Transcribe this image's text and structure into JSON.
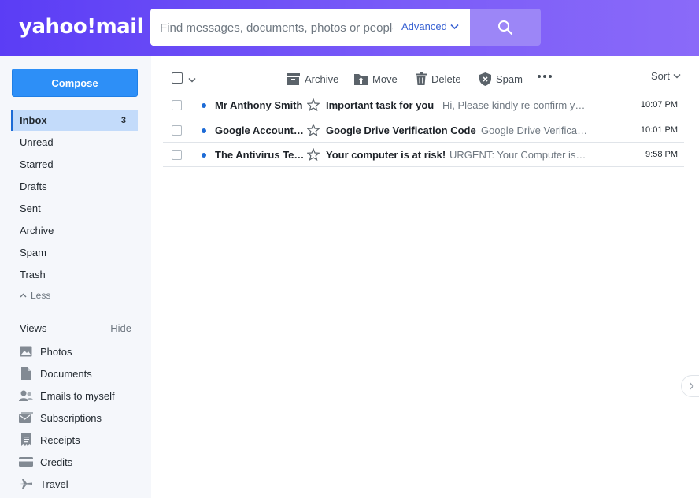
{
  "header": {
    "logo_text": "yahoo!mail",
    "search_placeholder": "Find messages, documents, photos or people",
    "advanced_label": "Advanced",
    "accent_color": "#5b3df5"
  },
  "sidebar": {
    "compose_label": "Compose",
    "folders": [
      {
        "label": "Inbox",
        "count": "3",
        "active": true
      },
      {
        "label": "Unread"
      },
      {
        "label": "Starred"
      },
      {
        "label": "Drafts"
      },
      {
        "label": "Sent"
      },
      {
        "label": "Archive"
      },
      {
        "label": "Spam"
      },
      {
        "label": "Trash"
      }
    ],
    "less_label": "Less",
    "views_label": "Views",
    "views_hide_label": "Hide",
    "views": [
      {
        "label": "Photos",
        "icon": "photo-icon"
      },
      {
        "label": "Documents",
        "icon": "document-icon"
      },
      {
        "label": "Emails to myself",
        "icon": "people-icon"
      },
      {
        "label": "Subscriptions",
        "icon": "subscriptions-icon"
      },
      {
        "label": "Receipts",
        "icon": "receipt-icon"
      },
      {
        "label": "Credits",
        "icon": "credit-card-icon"
      },
      {
        "label": "Travel",
        "icon": "plane-icon"
      }
    ]
  },
  "toolbar": {
    "archive_label": "Archive",
    "move_label": "Move",
    "delete_label": "Delete",
    "spam_label": "Spam",
    "sort_label": "Sort"
  },
  "messages": [
    {
      "sender": "Mr Anthony Smith",
      "subject": "Important task for you",
      "preview": "Hi, Please kindly re-confirm your details",
      "time": "10:07 PM",
      "unread": true
    },
    {
      "sender": "Google Accounts Team",
      "subject": "Google Drive Verification Code",
      "preview": "Google Drive Verification Code",
      "time": "10:01 PM",
      "unread": true
    },
    {
      "sender": "The Antivirus Team",
      "subject": "Your computer is at risk!",
      "preview": "URGENT: Your Computer is at risk",
      "time": "9:58 PM",
      "unread": true
    }
  ]
}
